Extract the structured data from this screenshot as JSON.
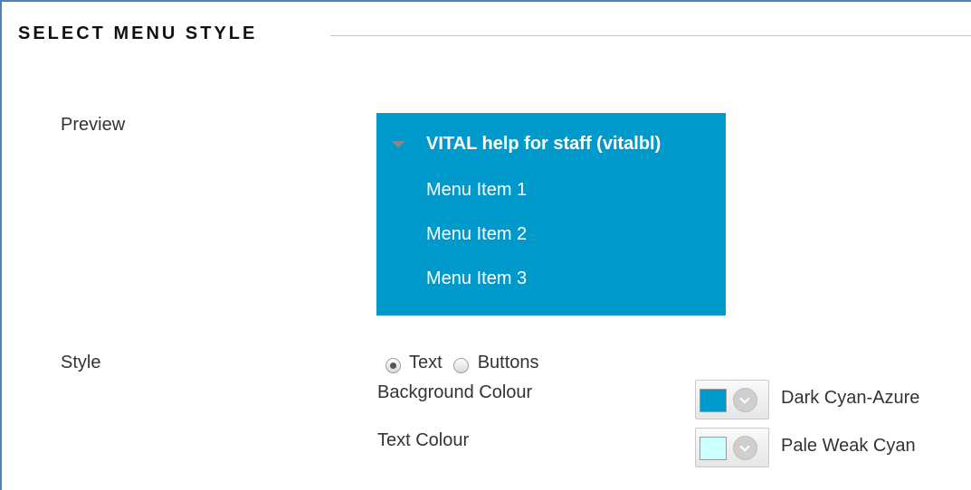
{
  "section": {
    "heading": "SELECT MENU STYLE"
  },
  "preview": {
    "label": "Preview",
    "title": "VITAL help for staff (vitalbl)",
    "items": [
      "Menu Item 1",
      "Menu Item 2",
      "Menu Item 3"
    ],
    "background_color": "#0099cc",
    "text_color": "#ffffff"
  },
  "style": {
    "label": "Style",
    "options": [
      {
        "label": "Text",
        "checked": true
      },
      {
        "label": "Buttons",
        "checked": false
      }
    ]
  },
  "background_colour": {
    "label": "Background Colour",
    "name": "Dark Cyan-Azure",
    "swatch": "#0099cc"
  },
  "text_colour": {
    "label": "Text Colour",
    "name": "Pale Weak Cyan",
    "swatch": "#ccffff"
  }
}
